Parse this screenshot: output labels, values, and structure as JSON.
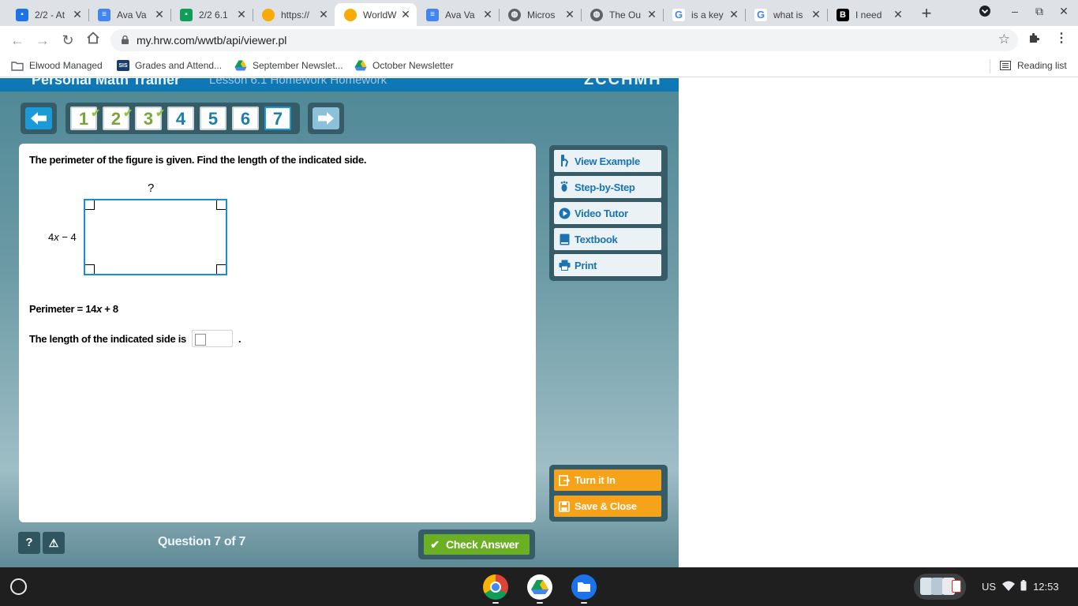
{
  "browser": {
    "tabs": [
      {
        "title": "2/2 - At",
        "favicon": "classroom-icon",
        "color": "#1a73e8",
        "active": false
      },
      {
        "title": "Ava Va",
        "favicon": "docs-icon",
        "color": "#4285f4",
        "active": false
      },
      {
        "title": "2/2 6.1",
        "favicon": "classroom-icon",
        "color": "#0f9d58",
        "active": false
      },
      {
        "title": "https://",
        "favicon": "circle-icon",
        "color": "#f9ab00",
        "active": false
      },
      {
        "title": "WorldW",
        "favicon": "circle-icon",
        "color": "#f9ab00",
        "active": true
      },
      {
        "title": "Ava Va",
        "favicon": "docs-icon",
        "color": "#4285f4",
        "active": false
      },
      {
        "title": "Micros",
        "favicon": "globe-icon",
        "color": "#5f6368",
        "active": false
      },
      {
        "title": "The Ou",
        "favicon": "globe-icon",
        "color": "#5f6368",
        "active": false
      },
      {
        "title": "is a key",
        "favicon": "google-icon",
        "color": "#4285f4",
        "active": false
      },
      {
        "title": "what is",
        "favicon": "google-icon",
        "color": "#4285f4",
        "active": false
      },
      {
        "title": "I need",
        "favicon": "brainly-icon",
        "color": "#000000",
        "active": false
      }
    ],
    "url": "my.hrw.com/wwtb/api/viewer.pl",
    "bookmarks": [
      {
        "label": "Elwood Managed",
        "icon": "folder-icon"
      },
      {
        "label": "Grades and Attend...",
        "icon": "sis-icon"
      },
      {
        "label": "September Newslet...",
        "icon": "drive-icon"
      },
      {
        "label": "October Newsletter",
        "icon": "drive-icon"
      }
    ],
    "reading_list": "Reading list",
    "sis_text": "SIS"
  },
  "app": {
    "header_title": "Personal Math Trainer",
    "header_sub": "Lesson 6.1    Homework    Homework",
    "header_logo": "ZCCHMH",
    "questions": [
      {
        "label": "1",
        "done": true
      },
      {
        "label": "2",
        "done": true
      },
      {
        "label": "3",
        "done": true
      },
      {
        "label": "4",
        "done": false
      },
      {
        "label": "5",
        "done": false
      },
      {
        "label": "6",
        "done": false
      },
      {
        "label": "7",
        "done": false,
        "current": true
      }
    ],
    "check_glyph": "✔",
    "question": {
      "prompt": "The perimeter of the figure is given. Find the length of the indicated side.",
      "unknown_side": "?",
      "side_coef": "4",
      "side_var": "x",
      "side_rest": " − 4",
      "perimeter_pre": "Perimeter = 14",
      "perimeter_var": "x",
      "perimeter_post": " + 8",
      "answer_label": "The length of the indicated side is",
      "answer_value": "",
      "period": "."
    },
    "tools": [
      {
        "label": "View Example",
        "icon": "hand-icon"
      },
      {
        "label": "Step-by-Step",
        "icon": "footprint-icon"
      },
      {
        "label": "Video Tutor",
        "icon": "play-icon"
      },
      {
        "label": "Textbook",
        "icon": "book-icon"
      },
      {
        "label": "Print",
        "icon": "printer-icon"
      }
    ],
    "actions": [
      {
        "label": "Turn it In",
        "icon": "turn-in-icon"
      },
      {
        "label": "Save & Close",
        "icon": "save-icon"
      }
    ],
    "help_label": "?",
    "alert_label": "⚠",
    "question_counter": "Question 7 of 7",
    "check_answer": "Check Answer",
    "colors": {
      "accent": "#1a9ad6",
      "orange": "#f7a31a",
      "green": "#6bb022",
      "frame": "#355c67"
    }
  },
  "shelf": {
    "locale": "US",
    "time": "12:53",
    "apps": [
      "chrome-icon",
      "drive-icon",
      "files-icon"
    ]
  }
}
